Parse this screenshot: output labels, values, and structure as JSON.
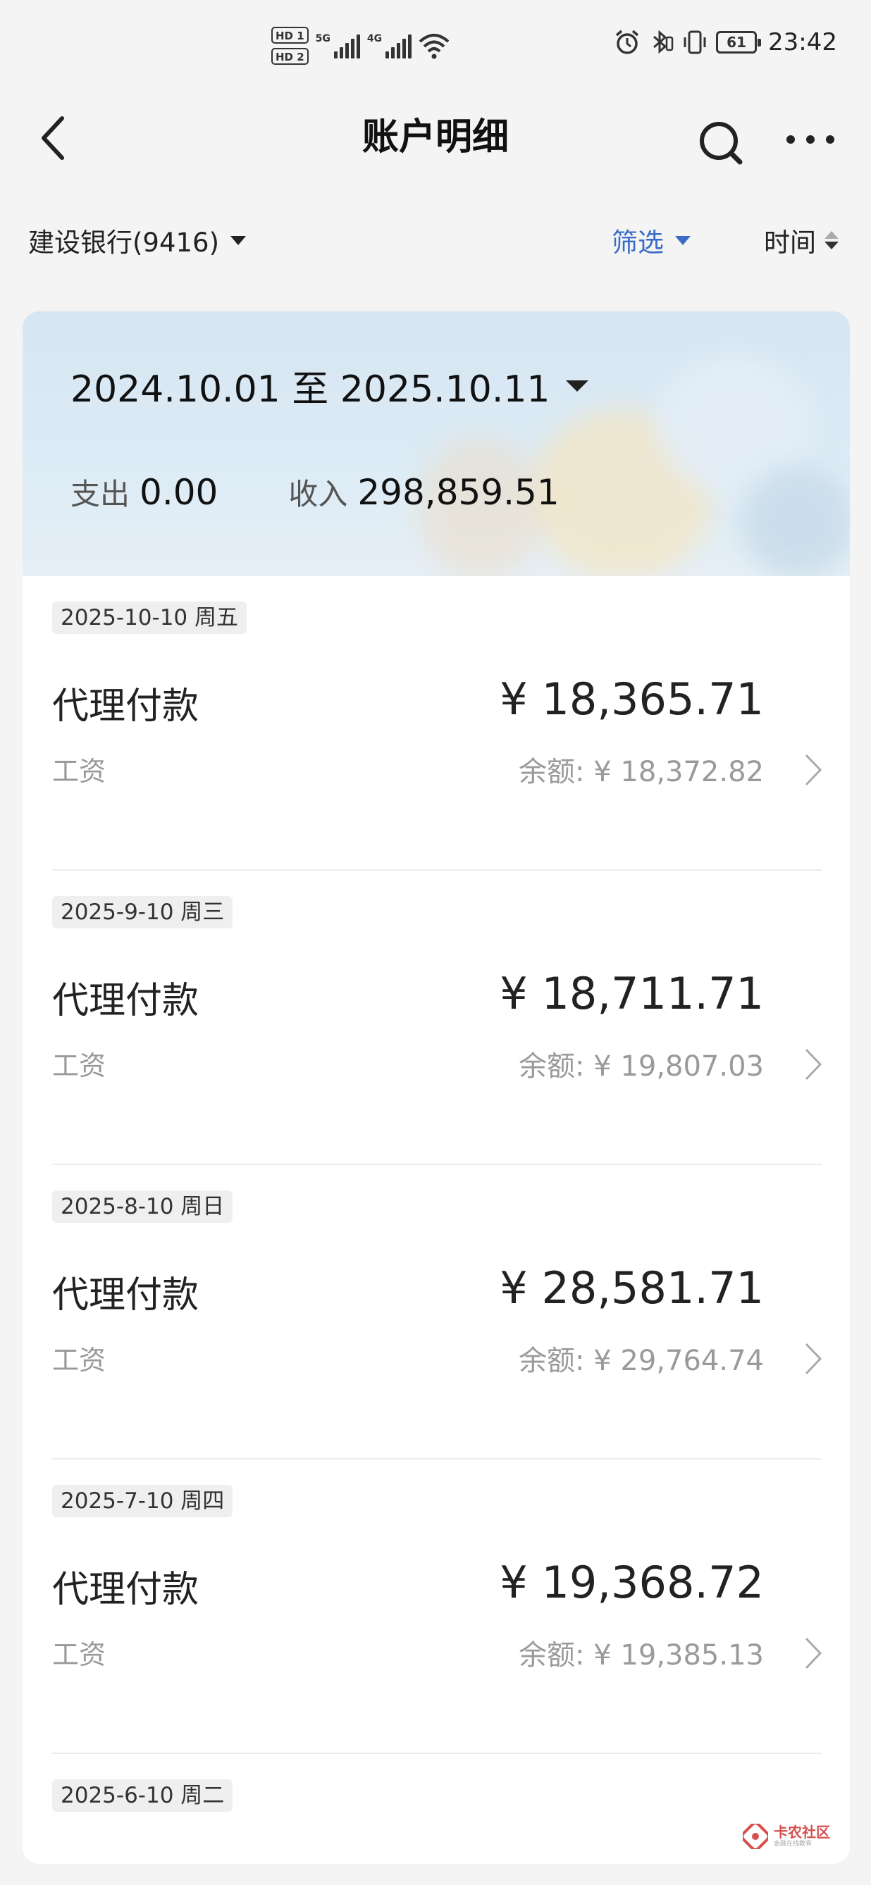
{
  "status_bar": {
    "hd1": "HD 1",
    "hd2": "HD 2",
    "sim1_gen": "5G",
    "sim2_gen": "4G",
    "battery": "61",
    "time": "23:42",
    "icons": [
      "alarm-icon",
      "bluetooth-icon",
      "vibrate-icon",
      "wifi-icon"
    ]
  },
  "nav": {
    "title": "账户明细",
    "icons": [
      "back-arrow-icon",
      "search-icon",
      "more-icon"
    ]
  },
  "filters": {
    "account": "建设银行(9416)",
    "filter_label": "筛选",
    "sort_label": "时间"
  },
  "summary": {
    "date_range": "2024.10.01 至 2025.10.11",
    "expense_label": "支出",
    "expense_value": "0.00",
    "income_label": "收入",
    "income_value": "298,859.51"
  },
  "transactions": [
    {
      "date": "2025-10-10 周五",
      "name": "代理付款",
      "amount": "¥ 18,365.71",
      "memo": "工资",
      "balance": "余额: ¥ 18,372.82"
    },
    {
      "date": "2025-9-10 周三",
      "name": "代理付款",
      "amount": "¥ 18,711.71",
      "memo": "工资",
      "balance": "余额: ¥ 19,807.03"
    },
    {
      "date": "2025-8-10 周日",
      "name": "代理付款",
      "amount": "¥ 28,581.71",
      "memo": "工资",
      "balance": "余额: ¥ 29,764.74"
    },
    {
      "date": "2025-7-10 周四",
      "name": "代理付款",
      "amount": "¥ 19,368.72",
      "memo": "工资",
      "balance": "余额: ¥ 19,385.13"
    },
    {
      "date": "2025-6-10 周二"
    }
  ],
  "watermark": {
    "main": "卡农社区",
    "sub": "金融在线教育"
  },
  "colors": {
    "accent": "#3a6cc7",
    "background": "#f4f4f4",
    "card": "#ffffff",
    "muted_text": "#999999"
  }
}
